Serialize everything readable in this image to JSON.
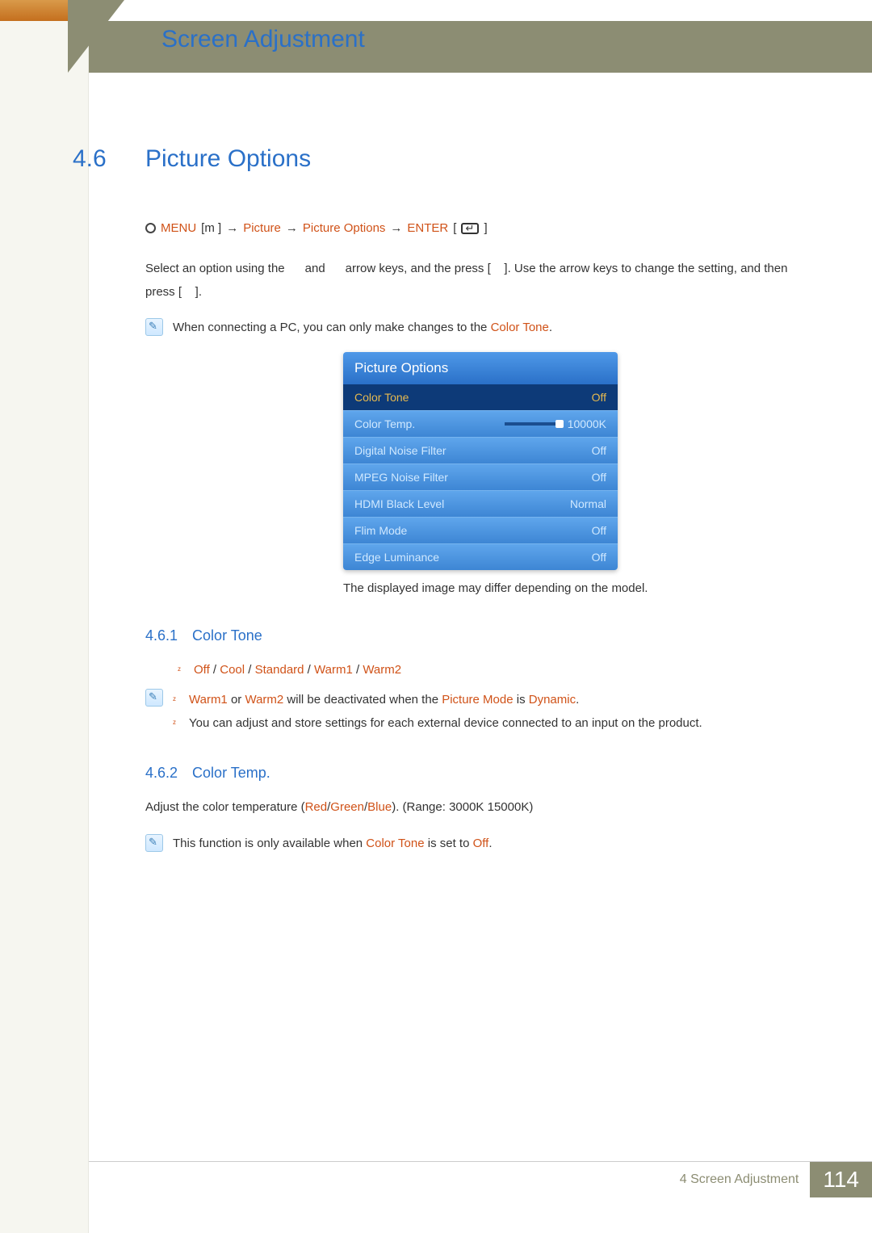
{
  "chapter_title": "Screen Adjustment",
  "section": {
    "number": "4.6",
    "title": "Picture Options"
  },
  "nav_path": {
    "menu": "MENU",
    "m": "m",
    "arrow": "→",
    "picture": "Picture",
    "picture_options": "Picture Options",
    "enter": "ENTER"
  },
  "intro_para": "Select an option using the      and      arrow keys, and the press [    ]. Use the arrow keys to change the setting, and then press [    ].",
  "note_pc_prefix": "When connecting a PC, you can only make changes to the ",
  "note_pc_highlight": "Color Tone",
  "note_pc_suffix": ".",
  "osd": {
    "title": "Picture Options",
    "rows": [
      {
        "label": "Color Tone",
        "value": "Off",
        "selected": true,
        "slider": false
      },
      {
        "label": "Color Temp.",
        "value": "10000K",
        "selected": false,
        "slider": true
      },
      {
        "label": "Digital Noise Filter",
        "value": "Off",
        "selected": false,
        "slider": false
      },
      {
        "label": "MPEG Noise Filter",
        "value": "Off",
        "selected": false,
        "slider": false
      },
      {
        "label": "HDMI Black Level",
        "value": "Normal",
        "selected": false,
        "slider": false
      },
      {
        "label": "Flim Mode",
        "value": "Off",
        "selected": false,
        "slider": false
      },
      {
        "label": "Edge Luminance",
        "value": "Off",
        "selected": false,
        "slider": false
      }
    ]
  },
  "osd_caption": "The displayed image may differ depending on the model.",
  "sub1": {
    "number": "4.6.1",
    "title": "Color Tone",
    "options": [
      "Off",
      "Cool",
      "Standard",
      "Warm1",
      "Warm2"
    ],
    "sep": " / ",
    "note1_parts": [
      "Warm1",
      " or ",
      "Warm2",
      " will be deactivated when the ",
      "Picture Mode",
      " is ",
      "Dynamic",
      "."
    ],
    "note2": "You can adjust and store settings for each external device connected to an input on the product."
  },
  "sub2": {
    "number": "4.6.2",
    "title": "Color Temp.",
    "para_prefix": "Adjust the color temperature (",
    "rgb": [
      "Red",
      "Green",
      "Blue"
    ],
    "rgb_sep": "/",
    "para_suffix": "). (Range: 3000K 15000K)",
    "note_prefix": "This function is only available when ",
    "note_hl1": "Color Tone",
    "note_mid": " is set to ",
    "note_hl2": "Off",
    "note_suffix": "."
  },
  "footer": {
    "chapter_num": "4",
    "chapter_label": "Screen Adjustment",
    "page": "114"
  }
}
